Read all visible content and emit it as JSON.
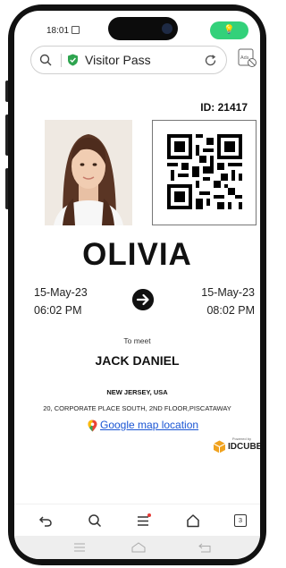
{
  "status_bar": {
    "time": "18:01",
    "badge": "💡"
  },
  "url_bar": {
    "title": "Visitor Pass"
  },
  "pass": {
    "id_label": "ID: 21417",
    "visitor_name": "OLIVIA",
    "from": {
      "date": "15-May-23",
      "time": "06:02 PM"
    },
    "to": {
      "date": "15-May-23",
      "time": "08:02 PM"
    },
    "to_meet_label": "To meet",
    "host_name": "JACK DANIEL",
    "location": "NEW JERSEY, USA",
    "address": "20, CORPORATE PLACE SOUTH, 2ND FLOOR,PISCATAWAY",
    "map_link": "Google map location",
    "powered_by": "Powered by",
    "brand": "IDCUBE"
  },
  "colors": {
    "accent_green": "#33d17a",
    "link_blue": "#1a55d4",
    "brand_orange": "#f0a21e"
  },
  "icons": [
    "search-icon",
    "shield-icon",
    "reload-icon",
    "ads-block-icon",
    "arrow-right-icon",
    "map-pin-icon",
    "idcube-logo-icon",
    "back-icon",
    "search-nav-icon",
    "menu-icon",
    "home-icon",
    "tabs-icon"
  ],
  "nav": {
    "tab_count": "3"
  }
}
